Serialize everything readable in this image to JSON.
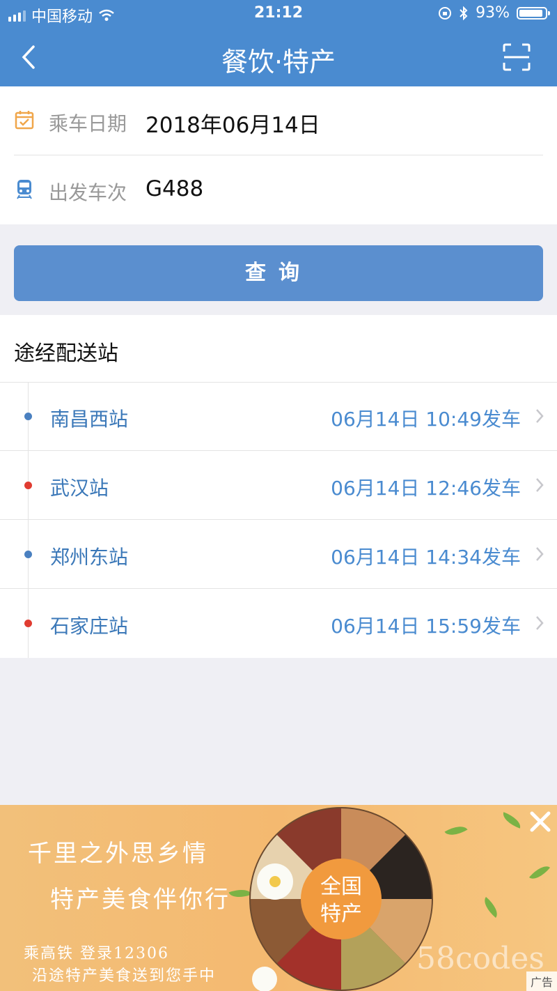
{
  "status_bar": {
    "carrier": "中国移动",
    "time": "21:12",
    "battery_text": "93%",
    "battery_level": 0.93
  },
  "nav": {
    "title": "餐饮·特产",
    "back_icon": "chevron-left-icon",
    "scan_icon": "scan-icon"
  },
  "form": {
    "date_label": "乘车日期",
    "date_value": "2018年06月14日",
    "train_label": "出发车次",
    "train_value": "G488"
  },
  "query_button": "查询",
  "stations_section": {
    "title": "途经配送站",
    "stations": [
      {
        "name": "南昌西站",
        "departure": "06月14日 10:49发车",
        "dot_color": "#4a80c0"
      },
      {
        "name": "武汉站",
        "departure": "06月14日 12:46发车",
        "dot_color": "#e03c31"
      },
      {
        "name": "郑州东站",
        "departure": "06月14日 14:34发车",
        "dot_color": "#4a80c0"
      },
      {
        "name": "石家庄站",
        "departure": "06月14日 15:59发车",
        "dot_color": "#e03c31"
      }
    ]
  },
  "ad": {
    "line1": "千里之外思乡情",
    "line2": "特产美食伴你行",
    "line3": "乘高铁   登录12306",
    "line4": "沿途特产美食送到您手中",
    "plate_text_1": "全国",
    "plate_text_2": "特产",
    "tag": "广告",
    "watermark": "58codes"
  },
  "colors": {
    "primary": "#4a8bd0",
    "button": "#5b8fcf",
    "background": "#efeff4"
  }
}
